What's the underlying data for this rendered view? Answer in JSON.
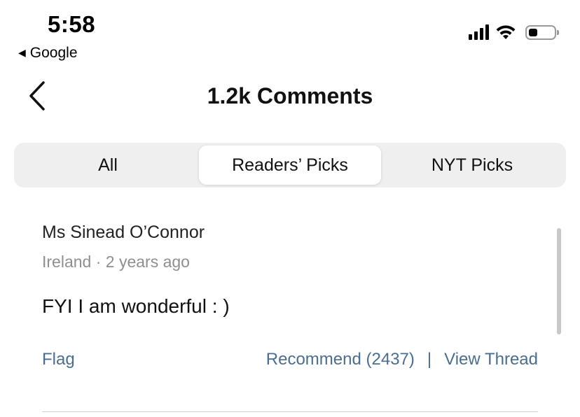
{
  "status_bar": {
    "time": "5:58",
    "back_app": "Google",
    "signal_bars": 4,
    "battery_level": 0.35
  },
  "header": {
    "title": "1.2k Comments",
    "back_icon": "chevron-left-icon"
  },
  "tabs": [
    {
      "label": "All",
      "active": false
    },
    {
      "label": "Readers’ Picks",
      "active": true
    },
    {
      "label": "NYT Picks",
      "active": false
    }
  ],
  "comment": {
    "author": "Ms Sinead O’Connor",
    "meta": "Ireland · 2 years ago",
    "text": "FYI I am wonderful : )",
    "flag_label": "Flag",
    "recommend_label": "Recommend (2437)",
    "separator": "|",
    "view_thread_label": "View Thread"
  },
  "colors": {
    "link": "#4a6e8f",
    "meta": "#8f8f8f",
    "segment_bg": "#efefef"
  }
}
